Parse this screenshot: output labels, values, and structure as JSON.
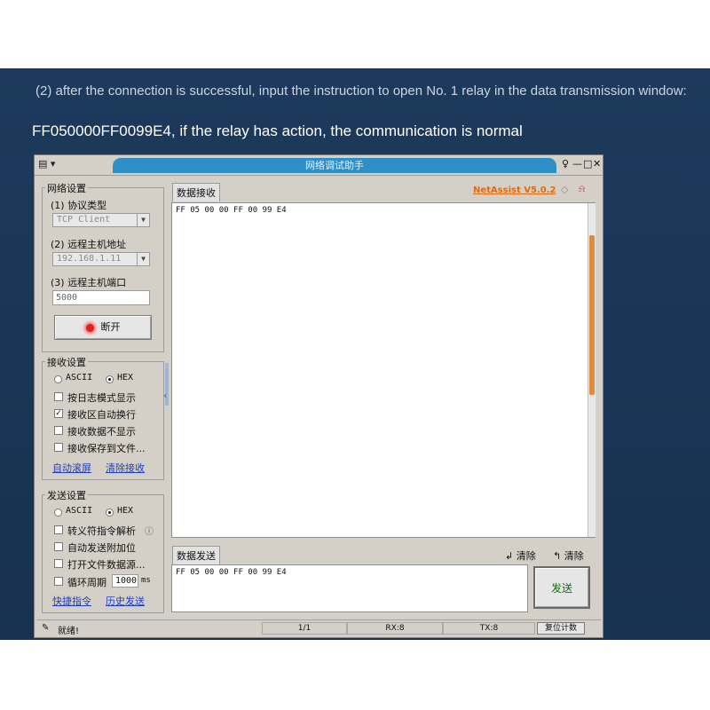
{
  "caption": {
    "line1": "(2) after the connection is successful, input the instruction to open No. 1 relay in the data transmission window:",
    "line2": "FF050000FF0099E4, if the relay has action, the communication is normal"
  },
  "window": {
    "title": "网络调试助手",
    "brand": "NetAssist V5.0.2",
    "controls": {
      "pin": "♀",
      "min": "—",
      "max": "□",
      "close": "✕"
    }
  },
  "network": {
    "group_title": "网络设置",
    "protocol_label": "(1) 协议类型",
    "protocol_value": "TCP Client",
    "host_label": "(2) 远程主机地址",
    "host_value": "192.168.1.11",
    "port_label": "(3) 远程主机端口",
    "port_value": "5000",
    "disconnect_label": "断开"
  },
  "receive": {
    "group_title": "接收设置",
    "ascii_label": "ASCII",
    "hex_label": "HEX",
    "mode": "HEX",
    "options": [
      {
        "label": "按日志模式显示",
        "checked": false
      },
      {
        "label": "接收区自动换行",
        "checked": true
      },
      {
        "label": "接收数据不显示",
        "checked": false
      },
      {
        "label": "接收保存到文件...",
        "checked": false
      }
    ],
    "link_auto_scroll": "自动滚屏",
    "link_clear": "清除接收",
    "tab": "数据接收",
    "content": "FF 05 00 00 FF 00 99 E4"
  },
  "send": {
    "group_title": "发送设置",
    "ascii_label": "ASCII",
    "hex_label": "HEX",
    "mode": "HEX",
    "options": [
      {
        "label": "转义符指令解析",
        "checked": false
      },
      {
        "label": "自动发送附加位",
        "checked": false
      },
      {
        "label": "打开文件数据源...",
        "checked": false
      },
      {
        "label": "循环周期",
        "checked": false
      }
    ],
    "cycle_value": "1000",
    "cycle_unit": "ms",
    "link_shortcut": "快捷指令",
    "link_history": "历史发送",
    "tab": "数据发送",
    "clear1": "清除",
    "clear2": "清除",
    "content": "FF 05 00 00 FF 00 99 E4",
    "send_button": "发送"
  },
  "status": {
    "text": "就绪!",
    "count": "1/1",
    "rx": "RX:8",
    "tx": "TX:8",
    "reset": "复位计数"
  }
}
